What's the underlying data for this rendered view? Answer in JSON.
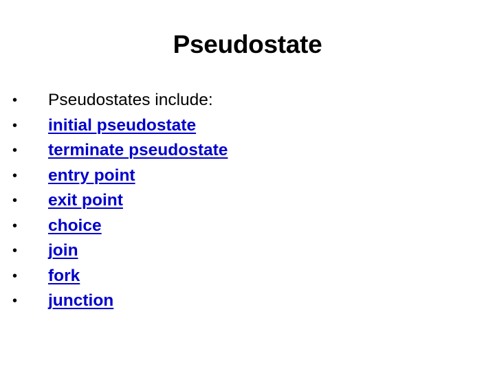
{
  "slide": {
    "title": "Pseudostate",
    "bullet_glyph": "•",
    "intro": "Pseudostates include:",
    "links": [
      "initial pseudostate",
      "terminate pseudostate",
      "entry point",
      "exit point",
      "choice",
      "join",
      "fork",
      "junction"
    ],
    "colors": {
      "link": "#0000cc",
      "text": "#000000",
      "background": "#ffffff"
    }
  }
}
